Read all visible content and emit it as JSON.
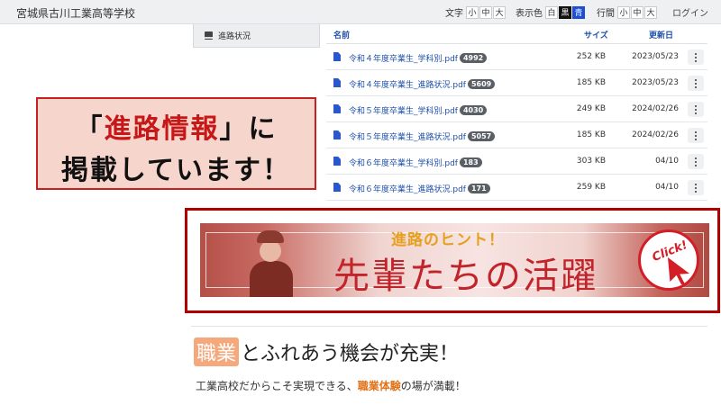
{
  "header": {
    "site_title": "宮城県古川工業高等学校",
    "font_size": {
      "label": "文字",
      "options": [
        "小",
        "中",
        "大"
      ]
    },
    "color": {
      "label": "表示色",
      "options": [
        "白",
        "黒",
        "青"
      ]
    },
    "line_height": {
      "label": "行間",
      "options": [
        "小",
        "中",
        "大"
      ]
    },
    "login": "ログイン"
  },
  "sidebar": {
    "item": "進路状況"
  },
  "table": {
    "headers": {
      "name": "名前",
      "size": "サイズ",
      "updated": "更新日"
    },
    "rows": [
      {
        "name": "令和４年度卒業生_学科別.pdf",
        "count": "4992",
        "size": "252 KB",
        "date": "2023/05/23"
      },
      {
        "name": "令和４年度卒業生_進路状況.pdf",
        "count": "5609",
        "size": "185 KB",
        "date": "2023/05/23"
      },
      {
        "name": "令和５年度卒業生_学科別.pdf",
        "count": "4030",
        "size": "249 KB",
        "date": "2024/02/26"
      },
      {
        "name": "令和５年度卒業生_進路状況.pdf",
        "count": "5057",
        "size": "185 KB",
        "date": "2024/02/26"
      },
      {
        "name": "令和６年度卒業生_学科別.pdf",
        "count": "183",
        "size": "303 KB",
        "date": "04/10"
      },
      {
        "name": "令和６年度卒業生_進路状況.pdf",
        "count": "171",
        "size": "259 KB",
        "date": "04/10"
      }
    ]
  },
  "callout": {
    "line1_open": "「",
    "line1_red": "進路情報",
    "line1_close": "」に",
    "line2": "掲載しています！"
  },
  "banner": {
    "hint": "進路のヒント！",
    "title": "先輩たちの活躍",
    "click": "Click!"
  },
  "section": {
    "heading_highlight": "職業",
    "heading_rest": "とふれあう機会が充実！",
    "sub_before": "工業高校だからこそ実現できる、",
    "sub_highlight": "職業体験",
    "sub_after": "の場が満載！"
  }
}
